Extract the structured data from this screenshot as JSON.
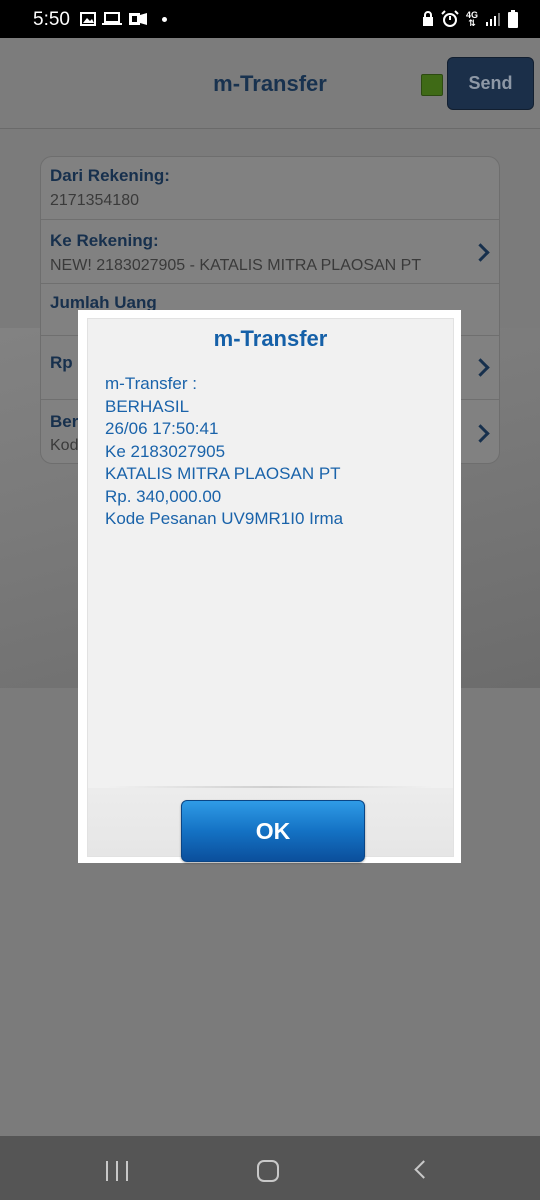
{
  "status_bar": {
    "time": "5:50",
    "network": "4G"
  },
  "header": {
    "title": "m-Transfer",
    "send_label": "Send"
  },
  "form": {
    "rows": [
      {
        "label": "Dari Rekening:",
        "value": "2171354180"
      },
      {
        "label": "Ke Rekening:",
        "value": "NEW! 2183027905 - KATALIS MITRA PLAOSAN PT"
      },
      {
        "label": "Jumlah Uang",
        "value": ""
      },
      {
        "label": "Rp",
        "value": ""
      },
      {
        "label": "Ber",
        "value": "Kod"
      }
    ]
  },
  "dialog": {
    "title": "m-Transfer",
    "message_lines": [
      "m-Transfer :",
      "BERHASIL",
      "26/06 17:50:41",
      "Ke 2183027905",
      "KATALIS MITRA PLAOSAN PT",
      "Rp. 340,000.00",
      "Kode Pesanan UV9MR1I0 Irma"
    ],
    "ok_label": "OK"
  },
  "colors": {
    "dialog_text": "#1a63aa",
    "ok_button": "#1472c4",
    "overlay": "#7b7b7b"
  }
}
